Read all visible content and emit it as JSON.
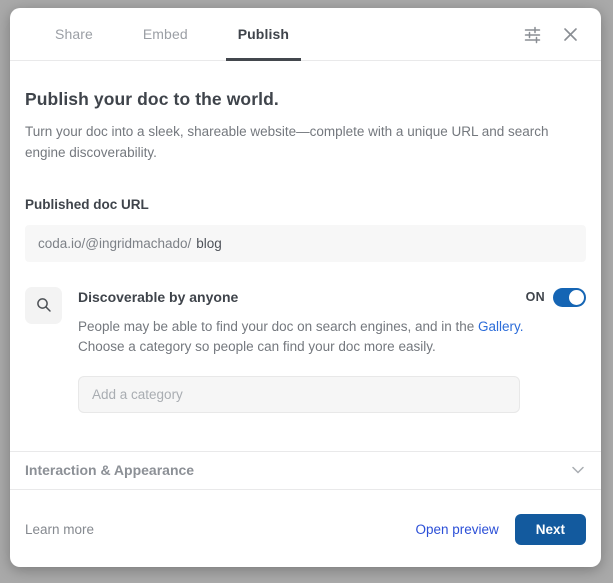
{
  "dialog": {
    "tabs": [
      {
        "label": "Share",
        "active": false
      },
      {
        "label": "Embed",
        "active": false
      },
      {
        "label": "Publish",
        "active": true
      }
    ],
    "title": "Publish your doc to the world.",
    "description": "Turn your doc into a sleek, shareable website—complete with a unique URL and search engine discoverability.",
    "url_section": {
      "label": "Published doc URL",
      "prefix": "coda.io/@ingridmachado/",
      "value": "blog"
    },
    "discoverable": {
      "title": "Discoverable by anyone",
      "toggle_label": "ON",
      "toggle_state": "on",
      "description_before": "People may be able to find your doc on search engines, and in the ",
      "gallery_link": "Gallery.",
      "description_after": " Choose a category so people can find your doc more easily.",
      "category_placeholder": "Add a category"
    },
    "sections": {
      "interaction_appearance": "Interaction & Appearance"
    },
    "footer": {
      "learn_more": "Learn more",
      "open_preview": "Open preview",
      "next": "Next"
    }
  },
  "icons": {
    "settings": "sliders-icon",
    "close": "close-icon",
    "search": "search-icon",
    "chevron": "chevron-down-icon"
  },
  "colors": {
    "toggle_on_blue": "#1565b4",
    "next_button_blue": "#135a9e",
    "open_preview_link_blue": "#2b4fd7",
    "gallery_link_blue": "#2b6cd9",
    "active_tab_underline": "#43474d",
    "backdrop_gray": "#a9a9a9"
  }
}
